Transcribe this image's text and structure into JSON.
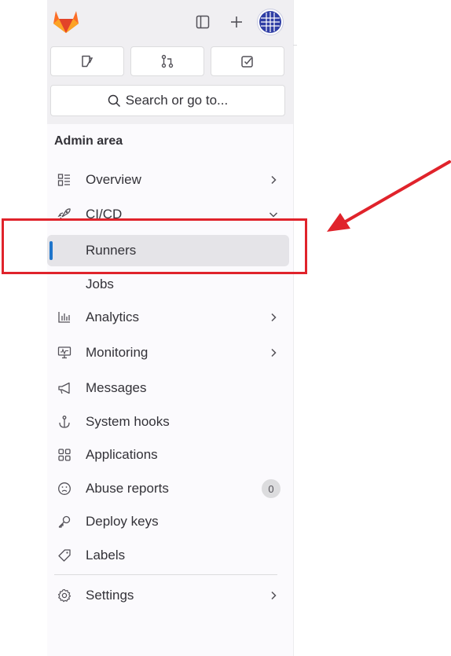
{
  "app": {
    "brand": "GitLab",
    "accent": "#1f75cb"
  },
  "topbar": {
    "sidebar_toggle_icon": "sidebar-toggle-icon",
    "new_icon": "plus-icon",
    "avatar_icon": "user-avatar"
  },
  "quick_actions": [
    {
      "icon": "issues-icon"
    },
    {
      "icon": "merge-request-icon"
    },
    {
      "icon": "todo-icon"
    }
  ],
  "search": {
    "label": "Search or go to...",
    "icon": "search-icon"
  },
  "section": {
    "title": "Admin area"
  },
  "nav": {
    "overview": {
      "label": "Overview",
      "icon": "overview-icon"
    },
    "cicd": {
      "label": "CI/CD",
      "icon": "rocket-icon"
    },
    "runners": {
      "label": "Runners"
    },
    "jobs": {
      "label": "Jobs"
    },
    "analytics": {
      "label": "Analytics",
      "icon": "chart-icon"
    },
    "monitoring": {
      "label": "Monitoring",
      "icon": "monitor-icon"
    },
    "messages": {
      "label": "Messages",
      "icon": "megaphone-icon"
    },
    "system_hooks": {
      "label": "System hooks",
      "icon": "anchor-icon"
    },
    "applications": {
      "label": "Applications",
      "icon": "applications-icon"
    },
    "abuse_reports": {
      "label": "Abuse reports",
      "icon": "sad-face-icon",
      "count": "0"
    },
    "deploy_keys": {
      "label": "Deploy keys",
      "icon": "key-icon"
    },
    "labels": {
      "label": "Labels",
      "icon": "label-icon"
    },
    "settings": {
      "label": "Settings",
      "icon": "gear-icon"
    }
  },
  "annotation": {
    "color": "#e0232b"
  }
}
